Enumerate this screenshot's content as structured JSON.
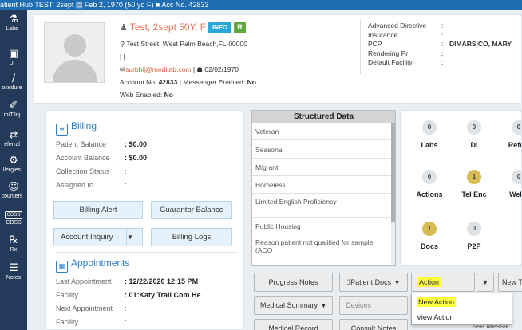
{
  "topbar": {
    "text": "atient Hub TEST, 2sept  ▤ Feb 2, 1970 (50 yo F)  ■ Acc No. 42833"
  },
  "sidenav": {
    "items": [
      {
        "label": "Labs",
        "icon": "flask-icon",
        "glyph": "⚗"
      },
      {
        "label": "DI",
        "icon": "monitor-icon",
        "glyph": "▣"
      },
      {
        "label": "ocedure",
        "icon": "scalpel-icon",
        "glyph": "∕"
      },
      {
        "label": "m/T.Inj",
        "icon": "syringe-icon",
        "glyph": "✐"
      },
      {
        "label": "eferral",
        "icon": "arrows-icon",
        "glyph": "⇄"
      },
      {
        "label": "llergies",
        "icon": "gear-icon",
        "glyph": "⚙"
      },
      {
        "label": "counters",
        "icon": "people-icon",
        "glyph": "☺"
      },
      {
        "label": "CDSS",
        "icon": "cdss-icon",
        "glyph": "CDSS"
      },
      {
        "label": "Rx",
        "icon": "rx-icon",
        "glyph": "℞"
      },
      {
        "label": "Notes",
        "icon": "notes-icon",
        "glyph": "☰"
      }
    ]
  },
  "patient": {
    "name": "Test, 2sept 50Y, F",
    "info_badge": "INFO",
    "green_badge": "R",
    "address": "Test Street, West Palm Beach,FL-00000",
    "phone": "| |",
    "email": "surbhij@meditab.com",
    "dob": "02/02/1970",
    "account_label": "Account No:",
    "account_no": "42833",
    "messenger_label": "| Messenger Enabled:",
    "messenger_value": "No",
    "web_label": "Web Enabled:",
    "web_value": "No",
    "web_tail": "|",
    "details": [
      {
        "key": "Advanced Directive",
        "value": ""
      },
      {
        "key": "Insurance",
        "value": ""
      },
      {
        "key": "PCP",
        "value": "DIMARSICO, MARY"
      },
      {
        "key": "Rendering Pr",
        "value": ""
      },
      {
        "key": "Default Facility",
        "value": ""
      }
    ]
  },
  "billing": {
    "title": "Billing",
    "rows": [
      {
        "key": "Patient Balance",
        "value": ": $0.00",
        "bold": true
      },
      {
        "key": "Account Balance",
        "value": ": $0.00",
        "bold": true
      },
      {
        "key": "Collection Status",
        "value": ":",
        "bold": false
      },
      {
        "key": "Assigned to",
        "value": ":",
        "bold": false
      }
    ],
    "buttons": {
      "billing_alert": "Billing Alert",
      "guarantor_balance": "Guarantor Balance",
      "account_inquiry": "Account Inquiry",
      "billing_logs": "Billing Logs"
    }
  },
  "appointments": {
    "title": "Appointments",
    "rows": [
      {
        "key": "Last Appointment",
        "value": ": 12/22/2020 12:15 PM",
        "bold": true
      },
      {
        "key": "Facility",
        "value": ": 01:Katy Trail Com He",
        "bold": true
      },
      {
        "key": "Next Appointment",
        "value": ":",
        "bold": false
      },
      {
        "key": "Facility",
        "value": ":",
        "bold": false
      }
    ]
  },
  "structured_data": {
    "title": "Structured Data",
    "items": [
      "Veteran",
      "Seasonal",
      "Migrant",
      "Homeless",
      "Limited English Proficiency",
      "Public Housing",
      "Reason patient not qualified for sample (ACO"
    ]
  },
  "counters": [
    {
      "label": "Labs",
      "count": "0",
      "highlight": false
    },
    {
      "label": "DI",
      "count": "0",
      "highlight": false
    },
    {
      "label": "Referr",
      "count": "0",
      "highlight": false
    },
    {
      "label": "Actions",
      "count": "0",
      "highlight": false
    },
    {
      "label": "Tel Enc",
      "count": "1",
      "highlight": true
    },
    {
      "label": "Web I",
      "count": "0",
      "highlight": false
    },
    {
      "label": "Docs",
      "count": "1",
      "highlight": true
    },
    {
      "label": "P2P",
      "count": "0",
      "highlight": false
    }
  ],
  "actions": {
    "progress_notes": "Progress Notes",
    "patient_docs": "Patient Docs",
    "action": "Action",
    "new_tel_enc": "New Tel Enc",
    "medical_summary": "Medical Summary",
    "devices": "Devices",
    "medical_record": "Medical Record",
    "consult_notes": "Consult Notes"
  },
  "dropdown": {
    "items": [
      "New Action",
      "View Action"
    ]
  },
  "bottom_clip": "sse  Messa",
  "colors": {
    "topbar": "#1f6db2",
    "sidenav": "#243a5a",
    "patient_name": "#e8735a",
    "section_title": "#2d7dc3",
    "highlight": "#ffff3a",
    "counter_highlight": "#d8bb52"
  }
}
